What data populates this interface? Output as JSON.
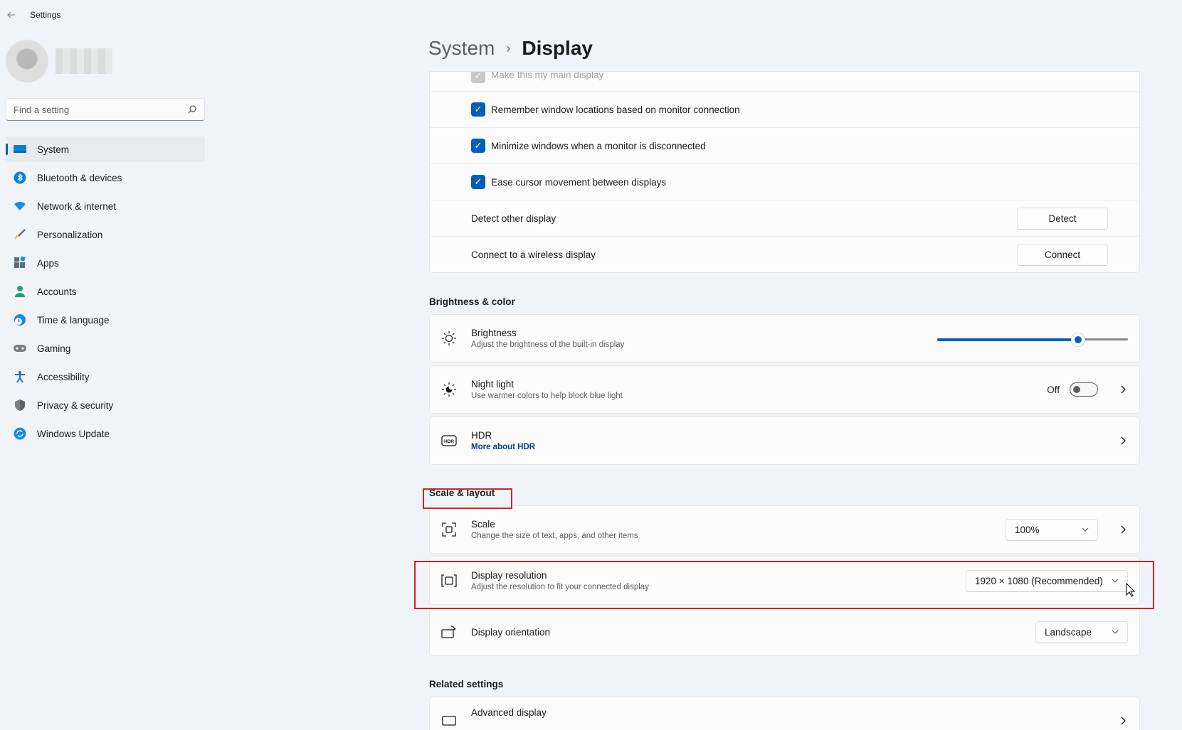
{
  "app": {
    "title": "Settings"
  },
  "search": {
    "placeholder": "Find a setting"
  },
  "nav": [
    {
      "label": "System",
      "icon": "monitor-icon",
      "active": true
    },
    {
      "label": "Bluetooth & devices",
      "icon": "bluetooth-icon"
    },
    {
      "label": "Network & internet",
      "icon": "wifi-icon"
    },
    {
      "label": "Personalization",
      "icon": "brush-icon"
    },
    {
      "label": "Apps",
      "icon": "apps-icon"
    },
    {
      "label": "Accounts",
      "icon": "person-icon"
    },
    {
      "label": "Time & language",
      "icon": "clock-globe-icon"
    },
    {
      "label": "Gaming",
      "icon": "gamepad-icon"
    },
    {
      "label": "Accessibility",
      "icon": "accessibility-icon"
    },
    {
      "label": "Privacy & security",
      "icon": "shield-icon"
    },
    {
      "label": "Windows Update",
      "icon": "update-icon"
    }
  ],
  "breadcrumb": {
    "parent": "System",
    "separator": "›",
    "current": "Display"
  },
  "multiple_displays": {
    "main_display": "Make this my main display",
    "remember_windows": "Remember window locations based on monitor connection",
    "minimize_windows": "Minimize windows when a monitor is disconnected",
    "ease_cursor": "Ease cursor movement between displays",
    "detect_label": "Detect other display",
    "detect_button": "Detect",
    "connect_label": "Connect to a wireless display",
    "connect_button": "Connect"
  },
  "brightness_color": {
    "title": "Brightness & color",
    "brightness": {
      "title": "Brightness",
      "subtitle": "Adjust the brightness of the built-in display",
      "value_fraction": 0.74
    },
    "night_light": {
      "title": "Night light",
      "subtitle": "Use warmer colors to help block blue light",
      "state": "Off"
    },
    "hdr": {
      "title": "HDR",
      "link": "More about HDR"
    }
  },
  "scale_layout": {
    "title": "Scale & layout",
    "scale": {
      "title": "Scale",
      "subtitle": "Change the size of text, apps, and other items",
      "value": "100%"
    },
    "resolution": {
      "title": "Display resolution",
      "subtitle": "Adjust the resolution to fit your connected display",
      "value": "1920 × 1080 (Recommended)"
    },
    "orientation": {
      "title": "Display orientation",
      "value": "Landscape"
    }
  },
  "related": {
    "title": "Related settings",
    "advanced_display": "Advanced display"
  },
  "colors": {
    "accent": "#005fb8",
    "highlight": "#d3222a"
  }
}
